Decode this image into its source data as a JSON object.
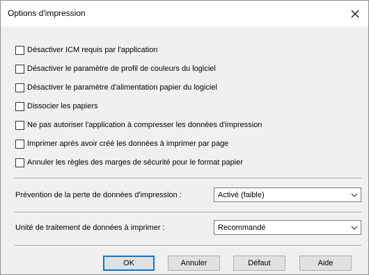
{
  "dialog": {
    "title": "Options d'impression",
    "close_icon": "close-icon"
  },
  "options": [
    {
      "label": "Désactiver ICM requis par l'application",
      "checked": false
    },
    {
      "label": "Désactiver le paramètre de profil de couleurs du logiciel",
      "checked": false
    },
    {
      "label": "Désactiver le paramètre d'alimentation papier du logiciel",
      "checked": false
    },
    {
      "label": "Dissocier les papiers",
      "checked": false
    },
    {
      "label": "Ne pas autoriser l'application à compresser les données d'impression",
      "checked": false
    },
    {
      "label": "Imprimer après avoir créé les données à imprimer par page",
      "checked": false
    },
    {
      "label": "Annuler les règles des marges de sécurité pour le format papier",
      "checked": false
    }
  ],
  "data_loss_prevention": {
    "label": "Prévention de la perte de données d'impression :",
    "value": "Activé (faible)"
  },
  "processing_unit": {
    "label": "Unité de traitement de données à imprimer :",
    "value": "Recommandé"
  },
  "buttons": {
    "ok": "OK",
    "cancel": "Annuler",
    "default": "Défaut",
    "help": "Aide"
  },
  "colors": {
    "focus_border": "#0078d7",
    "dialog_bg": "#f0f0f0"
  }
}
